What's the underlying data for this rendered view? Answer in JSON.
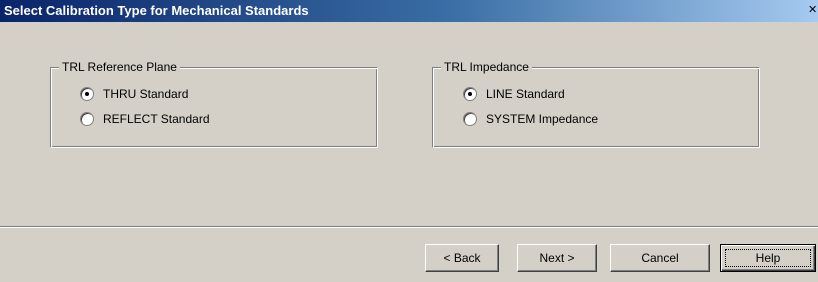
{
  "window": {
    "title": "Select Calibration Type for Mechanical Standards"
  },
  "groups": {
    "reference_plane": {
      "legend": "TRL Reference Plane",
      "options": [
        {
          "label": "THRU Standard",
          "selected": true
        },
        {
          "label": "REFLECT Standard",
          "selected": false
        }
      ]
    },
    "impedance": {
      "legend": "TRL Impedance",
      "options": [
        {
          "label": "LINE Standard",
          "selected": true
        },
        {
          "label": "SYSTEM Impedance",
          "selected": false
        }
      ]
    }
  },
  "buttons": {
    "back": "< Back",
    "next": "Next >",
    "cancel": "Cancel",
    "help": "Help"
  },
  "colors": {
    "title_bar_start": "#0a246a",
    "title_bar_end": "#a6caf0",
    "dialog_face": "#d4d0c8"
  }
}
